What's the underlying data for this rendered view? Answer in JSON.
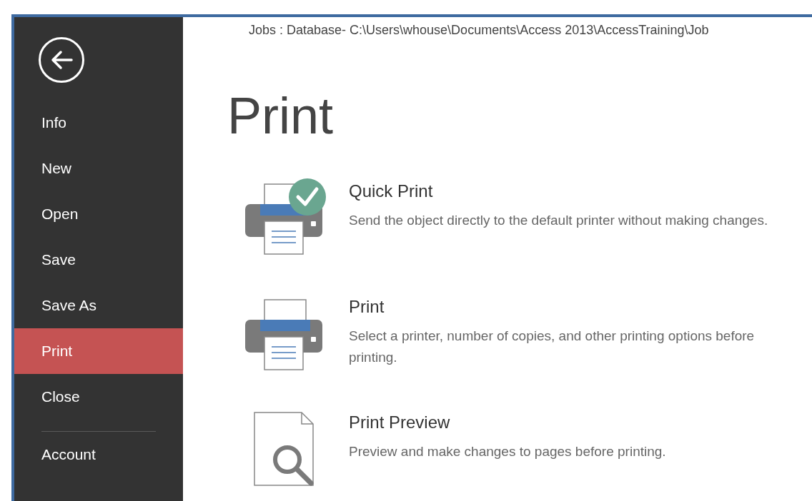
{
  "window": {
    "title": "Jobs : Database- C:\\Users\\whouse\\Documents\\Access 2013\\AccessTraining\\Job"
  },
  "sidebar": {
    "items": [
      {
        "label": "Info",
        "selected": false
      },
      {
        "label": "New",
        "selected": false
      },
      {
        "label": "Open",
        "selected": false
      },
      {
        "label": "Save",
        "selected": false
      },
      {
        "label": "Save As",
        "selected": false
      },
      {
        "label": "Print",
        "selected": true
      },
      {
        "label": "Close",
        "selected": false
      }
    ],
    "bottom_items": [
      {
        "label": "Account",
        "selected": false
      }
    ]
  },
  "page": {
    "heading": "Print",
    "options": [
      {
        "kind": "quick",
        "title": "Quick Print",
        "description": "Send the object directly to the default printer without making changes."
      },
      {
        "kind": "print",
        "title": "Print",
        "description": "Select a printer, number of copies, and other printing options before printing."
      },
      {
        "kind": "preview",
        "title": "Print Preview",
        "description": "Preview and make changes to pages before printing."
      }
    ]
  }
}
